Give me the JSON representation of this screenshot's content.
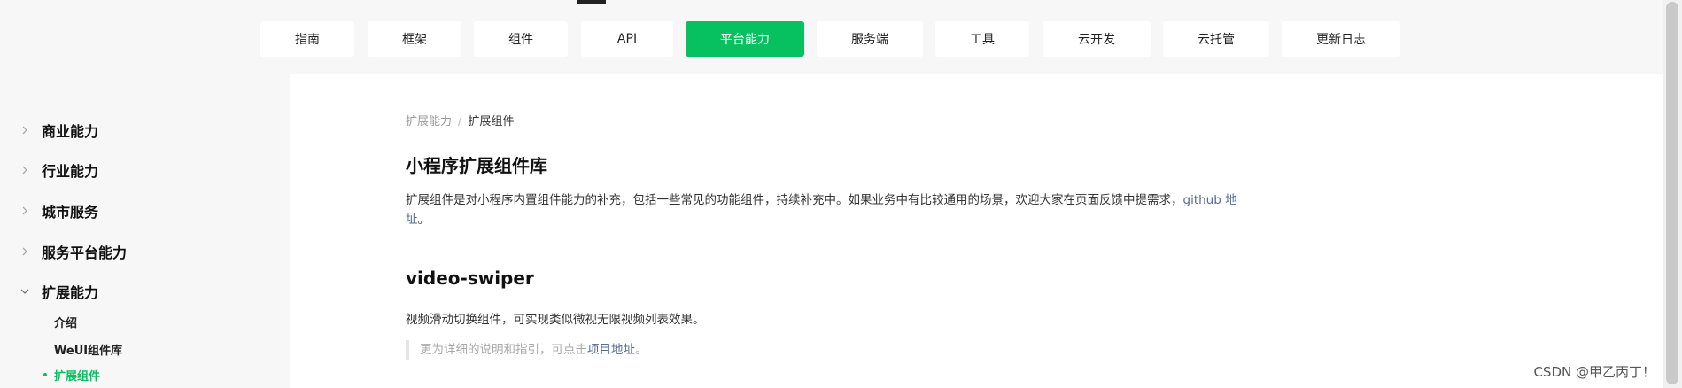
{
  "topnav": {
    "tabs": [
      {
        "label": "指南"
      },
      {
        "label": "框架"
      },
      {
        "label": "组件"
      },
      {
        "label": "API"
      },
      {
        "label": "平台能力",
        "active": true
      },
      {
        "label": "服务端"
      },
      {
        "label": "工具"
      },
      {
        "label": "云开发"
      },
      {
        "label": "云托管"
      },
      {
        "label": "更新日志"
      }
    ],
    "active_color": "#07c160"
  },
  "sidebar": {
    "items": [
      {
        "label": "商业能力",
        "expanded": false
      },
      {
        "label": "行业能力",
        "expanded": false
      },
      {
        "label": "城市服务",
        "expanded": false
      },
      {
        "label": "服务平台能力",
        "expanded": false
      },
      {
        "label": "扩展能力",
        "expanded": true
      }
    ],
    "sub_items": [
      {
        "label": "介绍"
      },
      {
        "label": "WeUI组件库"
      },
      {
        "label": "扩展组件",
        "current": true
      }
    ]
  },
  "main": {
    "breadcrumb": {
      "parent": "扩展能力",
      "separator": "/",
      "current": "扩展组件"
    },
    "title": "小程序扩展组件库",
    "intro_text": "扩展组件是对小程序内置组件能力的补充，包括一些常见的功能组件，持续补充中。如果业务中有比较通用的场景，欢迎大家在页面反馈中提需求，",
    "intro_link": "github 地址",
    "intro_end": "。",
    "section_title": "video-swiper",
    "section_desc": "视频滑动切换组件，可实现类似微视无限视频列表效果。",
    "quote_text": "更为详细的说明和指引，可点击",
    "quote_link": "项目地址",
    "quote_end": "。"
  },
  "watermark": "CSDN @甲乙丙丁！"
}
